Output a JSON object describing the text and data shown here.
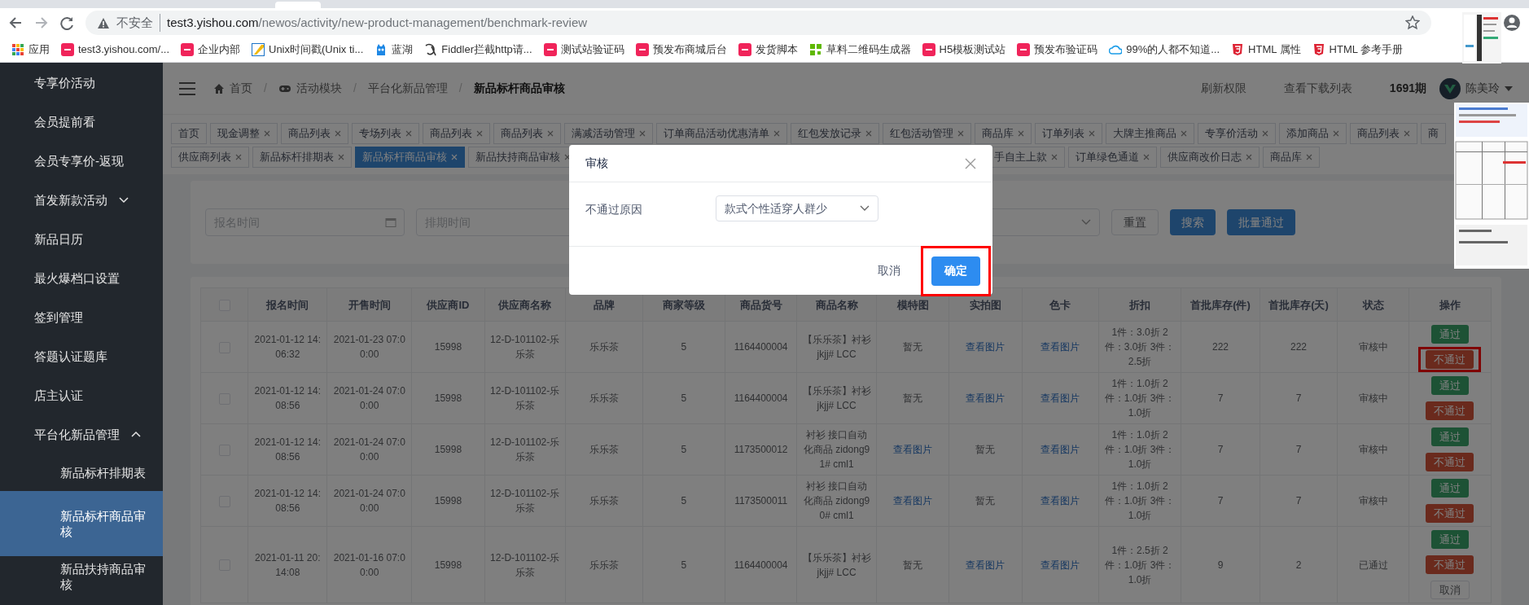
{
  "address_bar": {
    "security": "不安全",
    "host": "test3.yishou.com",
    "path": "/newos/activity/new-product-management/benchmark-review"
  },
  "bookmarks": [
    {
      "kind": "apps",
      "label": "应用"
    },
    {
      "kind": "brand",
      "label": "test3.yishou.com/..."
    },
    {
      "kind": "brand",
      "label": "企业内部"
    },
    {
      "kind": "unix",
      "label": "Unix时间戳(Unix ti..."
    },
    {
      "kind": "lanhu",
      "label": "蓝湖"
    },
    {
      "kind": "fiddler",
      "label": "Fiddler拦截http请..."
    },
    {
      "kind": "brand",
      "label": "测试站验证码"
    },
    {
      "kind": "brand",
      "label": "预发布商城后台"
    },
    {
      "kind": "brand",
      "label": "发货脚本"
    },
    {
      "kind": "qrcode",
      "label": "草料二维码生成器"
    },
    {
      "kind": "brand",
      "label": "H5模板测试站"
    },
    {
      "kind": "brand",
      "label": "预发布验证码"
    },
    {
      "kind": "cloud",
      "label": "99%的人都不知道..."
    },
    {
      "kind": "html",
      "label": "HTML 属性"
    },
    {
      "kind": "html",
      "label": "HTML 参考手册"
    }
  ],
  "sidebar": {
    "items": [
      {
        "label": "专享价活动",
        "selected": false
      },
      {
        "label": "会员提前看",
        "selected": false
      },
      {
        "label": "会员专享价-返现",
        "selected": false
      },
      {
        "label": "首发新款活动",
        "selected": false,
        "expanded": false
      },
      {
        "label": "新品日历",
        "selected": false
      },
      {
        "label": "最火爆档口设置",
        "selected": false
      },
      {
        "label": "签到管理",
        "selected": false
      },
      {
        "label": "答题认证题库",
        "selected": false
      },
      {
        "label": "店主认证",
        "selected": false
      },
      {
        "label": "平台化新品管理",
        "selected": false,
        "expanded": true,
        "children": [
          {
            "label": "新品标杆排期表",
            "selected": false
          },
          {
            "label": "新品标杆商品审核",
            "selected": true
          },
          {
            "label": "新品扶持商品审核",
            "selected": false
          }
        ]
      }
    ]
  },
  "header": {
    "breadcrumbs": [
      {
        "label": "首页",
        "kind": "home",
        "current": false
      },
      {
        "label": "活动模块",
        "kind": "game",
        "current": false
      },
      {
        "label": "平台化新品管理",
        "current": false
      },
      {
        "label": "新品标杆商品审核",
        "current": true
      }
    ],
    "separators": [
      "/",
      "/",
      "/"
    ],
    "links": [
      "刷新权限",
      "查看下载列表"
    ],
    "period": "1691期",
    "user": "陈美玲"
  },
  "tab_rows": [
    {
      "tabs": [
        {
          "label": "首页",
          "closable": false,
          "selected": false
        },
        {
          "label": "现金调整",
          "closable": true,
          "selected": false
        },
        {
          "label": "商品列表",
          "closable": true,
          "selected": false
        },
        {
          "label": "专场列表",
          "closable": true,
          "selected": false
        },
        {
          "label": "商品列表",
          "closable": true,
          "selected": false
        },
        {
          "label": "商品列表",
          "closable": true,
          "selected": false
        },
        {
          "label": "满减活动管理",
          "closable": true,
          "selected": false
        },
        {
          "label": "订单商品活动优惠清单",
          "closable": true,
          "selected": false
        },
        {
          "label": "红包发放记录",
          "closable": true,
          "selected": false
        },
        {
          "label": "红包活动管理",
          "closable": true,
          "selected": false
        },
        {
          "label": "商品库",
          "closable": true,
          "selected": false
        },
        {
          "label": "订单列表",
          "closable": true,
          "selected": false
        },
        {
          "label": "大牌主推商品",
          "closable": true,
          "selected": false
        },
        {
          "label": "专享价活动",
          "closable": true,
          "selected": false
        },
        {
          "label": "添加商品",
          "closable": true,
          "selected": false
        },
        {
          "label": "商品列表",
          "closable": true,
          "selected": false
        },
        {
          "label": "商",
          "closable": false,
          "selected": false
        }
      ]
    },
    {
      "tabs": [
        {
          "label": "供应商列表",
          "closable": true,
          "selected": false
        },
        {
          "label": "新品标杆排期表",
          "closable": true,
          "selected": false
        },
        {
          "label": "新品标杆商品审核",
          "closable": true,
          "selected": true
        },
        {
          "label": "新品扶持商品审核",
          "closable": true,
          "selected": false
        },
        {
          "label": "手自主上款",
          "closable": true,
          "selected": false,
          "clipped": true
        },
        {
          "label": "订单绿色通道",
          "closable": true,
          "selected": false
        },
        {
          "label": "供应商改价日志",
          "closable": true,
          "selected": false
        },
        {
          "label": "商品库",
          "closable": true,
          "selected": false
        }
      ]
    }
  ],
  "filters": {
    "fields": [
      {
        "kind": "date",
        "placeholder": "报名时间"
      },
      {
        "kind": "text",
        "placeholder": "排期时间"
      },
      {
        "kind": "select"
      }
    ],
    "buttons": [
      {
        "label": "重置",
        "kind": "plain"
      },
      {
        "label": "搜索",
        "kind": "primary"
      },
      {
        "label": "批量通过",
        "kind": "primary"
      }
    ]
  },
  "table": {
    "select_all_checked": false,
    "columns": [
      "报名时间",
      "开售时间",
      "供应商ID",
      "供应商名称",
      "品牌",
      "商家等级",
      "商品货号",
      "商品名称",
      "模特图",
      "实拍图",
      "色卡",
      "折扣",
      "首批库存(件)",
      "首批库存(天)",
      "状态",
      "操作"
    ],
    "rows": [
      {
        "checked": false,
        "cells": [
          "2021-01-12 14:06:32",
          "2021-01-23 07:00:00",
          "15998",
          "12-D-101102-乐乐茶",
          "乐乐茶",
          "5",
          "1164400004",
          "【乐乐茶】衬衫jkjj# LCC",
          {
            "text": "暂无",
            "link": false
          },
          {
            "text": "查看图片",
            "link": true
          },
          {
            "text": "查看图片",
            "link": true
          },
          "1件：3.0折 2件：3.0折 3件：2.5折",
          "222",
          "222",
          "审核中"
        ],
        "actions": [
          {
            "label": "通过",
            "kind": "approve",
            "highlighted": false
          },
          {
            "label": "不通过",
            "kind": "reject",
            "highlighted": true
          }
        ]
      },
      {
        "checked": false,
        "cells": [
          "2021-01-12 14:08:56",
          "2021-01-24 07:00:00",
          "15998",
          "12-D-101102-乐乐茶",
          "乐乐茶",
          "5",
          "1164400004",
          "【乐乐茶】衬衫jkjj# LCC",
          {
            "text": "暂无",
            "link": false
          },
          {
            "text": "查看图片",
            "link": true
          },
          {
            "text": "查看图片",
            "link": true
          },
          "1件：1.0折 2件：1.0折 3件：1.0折",
          "7",
          "7",
          "审核中"
        ],
        "actions": [
          {
            "label": "通过",
            "kind": "approve",
            "highlighted": false
          },
          {
            "label": "不通过",
            "kind": "reject",
            "highlighted": false
          }
        ]
      },
      {
        "checked": false,
        "cells": [
          "2021-01-12 14:08:56",
          "2021-01-24 07:00:00",
          "15998",
          "12-D-101102-乐乐茶",
          "乐乐茶",
          "5",
          "1173500012",
          "衬衫 接口自动化商品 zidong91# cml1",
          {
            "text": "查看图片",
            "link": true
          },
          {
            "text": "暂无",
            "link": false
          },
          {
            "text": "查看图片",
            "link": true
          },
          "1件：1.0折 2件：1.0折 3件：1.0折",
          "7",
          "7",
          "审核中"
        ],
        "actions": [
          {
            "label": "通过",
            "kind": "approve",
            "highlighted": false
          },
          {
            "label": "不通过",
            "kind": "reject",
            "highlighted": false
          }
        ]
      },
      {
        "checked": false,
        "cells": [
          "2021-01-12 14:08:56",
          "2021-01-24 07:00:00",
          "15998",
          "12-D-101102-乐乐茶",
          "乐乐茶",
          "5",
          "1173500011",
          "衬衫 接口自动化商品 zidong90# cml1",
          {
            "text": "查看图片",
            "link": true
          },
          {
            "text": "暂无",
            "link": false
          },
          {
            "text": "查看图片",
            "link": true
          },
          "1件：1.0折 2件：1.0折 3件：1.0折",
          "7",
          "7",
          "审核中"
        ],
        "actions": [
          {
            "label": "通过",
            "kind": "approve",
            "highlighted": false
          },
          {
            "label": "不通过",
            "kind": "reject",
            "highlighted": false
          }
        ]
      },
      {
        "checked": false,
        "cells": [
          "2021-01-11 20:14:08",
          "2021-01-16 07:00:00",
          "15998",
          "12-D-101102-乐乐茶",
          "乐乐茶",
          "5",
          "1164400004",
          "【乐乐茶】衬衫jkjj# LCC",
          {
            "text": "暂无",
            "link": false
          },
          {
            "text": "查看图片",
            "link": true
          },
          {
            "text": "查看图片",
            "link": true
          },
          "1件：2.5折 2件：1.0折 3件：1.0折",
          "9",
          "2",
          "已通过"
        ],
        "actions": [
          {
            "label": "通过",
            "kind": "approve",
            "highlighted": false
          },
          {
            "label": "不通过",
            "kind": "reject",
            "highlighted": false
          },
          {
            "label": "取消",
            "kind": "cancel",
            "highlighted": false
          }
        ]
      }
    ]
  },
  "dialog": {
    "title": "审核",
    "field_label": "不通过原因",
    "reason": "款式个性适穿人群少",
    "buttons": [
      {
        "label": "取消",
        "kind": "text",
        "highlighted": false
      },
      {
        "label": "确定",
        "kind": "primary",
        "highlighted": true
      }
    ]
  }
}
